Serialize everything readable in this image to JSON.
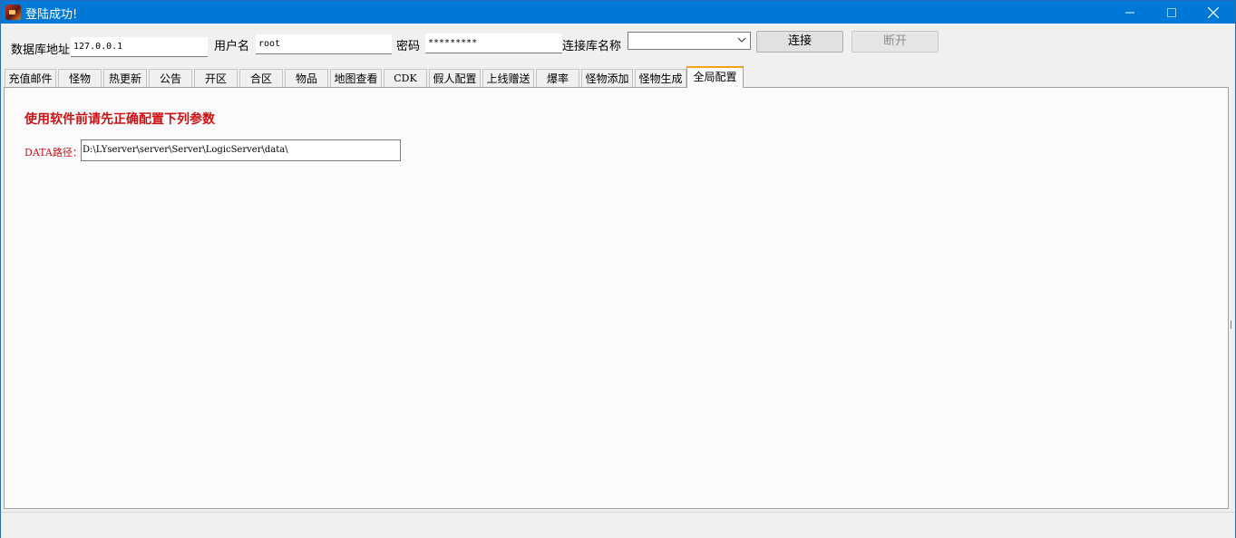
{
  "window": {
    "title": "登陆成功!"
  },
  "connection": {
    "db_address_label": "数据库地址",
    "db_address_value": "127.0.0.1",
    "username_label": "用户名",
    "username_value": "root",
    "password_label": "密码",
    "password_value": "*********",
    "db_name_label": "连接库名称",
    "db_name_value": "",
    "connect_label": "连接",
    "disconnect_label": "断开"
  },
  "tabs": [
    {
      "label": "充值邮件"
    },
    {
      "label": "怪物"
    },
    {
      "label": "热更新"
    },
    {
      "label": "公告"
    },
    {
      "label": "开区"
    },
    {
      "label": "合区"
    },
    {
      "label": "物品"
    },
    {
      "label": "地图查看"
    },
    {
      "label": "CDK"
    },
    {
      "label": "假人配置"
    },
    {
      "label": "上线赠送"
    },
    {
      "label": "爆率"
    },
    {
      "label": "怪物添加"
    },
    {
      "label": "怪物生成"
    },
    {
      "label": "全局配置"
    }
  ],
  "active_tab": "全局配置",
  "global_config": {
    "notice": "使用软件前请先正确配置下列参数",
    "data_path_label": "DATA路径：",
    "data_path_value": "D:\\LYserver\\server\\Server\\LogicServer\\data\\"
  },
  "colors": {
    "titlebar": "#0078d7",
    "notice_red": "#d01010",
    "active_tab_accent": "#f4a21c"
  },
  "icons": {
    "app": "app-game-icon",
    "minimize": "minimize-icon",
    "maximize": "maximize-icon",
    "close": "close-icon",
    "dropdown": "chevron-down-icon"
  }
}
